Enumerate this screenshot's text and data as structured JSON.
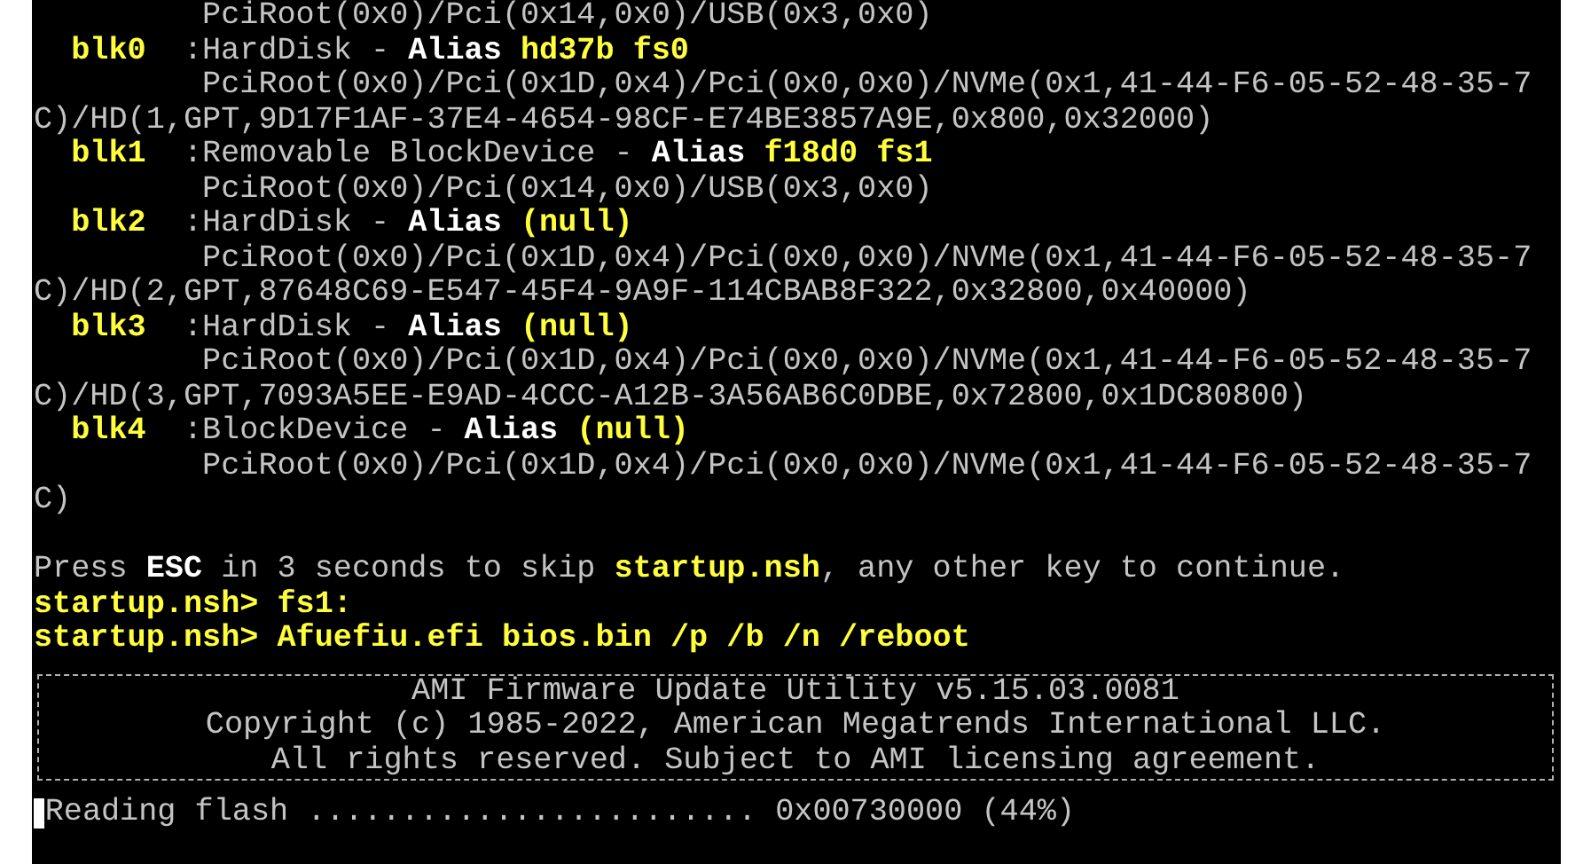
{
  "lines": [
    {
      "kind": "path",
      "text": "PciRoot(0x0)/Pci(0x14,0x0)/USB(0x3,0x0)"
    },
    {
      "kind": "device",
      "name": "blk0",
      "type": ":HardDisk -",
      "alias_label": "Alias",
      "alias": "hd37b fs0"
    },
    {
      "kind": "path",
      "text": "PciRoot(0x0)/Pci(0x1D,0x4)/Pci(0x0,0x0)/NVMe(0x1,41-44-F6-05-52-48-35-7"
    },
    {
      "kind": "wrap",
      "text": "C)/HD(1,GPT,9D17F1AF-37E4-4654-98CF-E74BE3857A9E,0x800,0x32000)"
    },
    {
      "kind": "device",
      "name": "blk1",
      "type": ":Removable BlockDevice -",
      "alias_label": "Alias",
      "alias": "f18d0 fs1"
    },
    {
      "kind": "path",
      "text": "PciRoot(0x0)/Pci(0x14,0x0)/USB(0x3,0x0)"
    },
    {
      "kind": "device",
      "name": "blk2",
      "type": ":HardDisk -",
      "alias_label": "Alias",
      "alias": "(null)"
    },
    {
      "kind": "path",
      "text": "PciRoot(0x0)/Pci(0x1D,0x4)/Pci(0x0,0x0)/NVMe(0x1,41-44-F6-05-52-48-35-7"
    },
    {
      "kind": "wrap",
      "text": "C)/HD(2,GPT,87648C69-E547-45F4-9A9F-114CBAB8F322,0x32800,0x40000)"
    },
    {
      "kind": "device",
      "name": "blk3",
      "type": ":HardDisk -",
      "alias_label": "Alias",
      "alias": "(null)"
    },
    {
      "kind": "path",
      "text": "PciRoot(0x0)/Pci(0x1D,0x4)/Pci(0x0,0x0)/NVMe(0x1,41-44-F6-05-52-48-35-7"
    },
    {
      "kind": "wrap",
      "text": "C)/HD(3,GPT,7093A5EE-E9AD-4CCC-A12B-3A56AB6C0DBE,0x72800,0x1DC80800)"
    },
    {
      "kind": "device",
      "name": "blk4",
      "type": ":BlockDevice -",
      "alias_label": "Alias",
      "alias": "(null)"
    },
    {
      "kind": "path",
      "text": "PciRoot(0x0)/Pci(0x1D,0x4)/Pci(0x0,0x0)/NVMe(0x1,41-44-F6-05-52-48-35-7"
    },
    {
      "kind": "wrap",
      "text": "C)"
    },
    {
      "kind": "blank"
    },
    {
      "kind": "message",
      "segments": [
        {
          "kind": "plain",
          "text": "Press"
        },
        {
          "kind": "key",
          "text": "ESC"
        },
        {
          "kind": "plain",
          "text": "in 3 seconds to skip"
        },
        {
          "kind": "file",
          "text": "startup.nsh"
        },
        {
          "kind": "suffix",
          "text": ", any other key to continue."
        }
      ]
    },
    {
      "kind": "command",
      "prompt": "startup.nsh>",
      "text": "fs1:"
    },
    {
      "kind": "command",
      "prompt": "startup.nsh>",
      "text": "Afuefiu.efi bios.bin /p /b /n /reboot"
    },
    {
      "kind": "banner",
      "texts": [
        "AMI Firmware Update Utility v5.15.03.0081",
        "Copyright (c) 1985-2022, American Megatrends International LLC.",
        "All rights reserved. Subject to AMI licensing agreement."
      ]
    },
    {
      "kind": "progress",
      "label": "Reading flash ........................",
      "value": "0x00730000 (44%)"
    }
  ]
}
